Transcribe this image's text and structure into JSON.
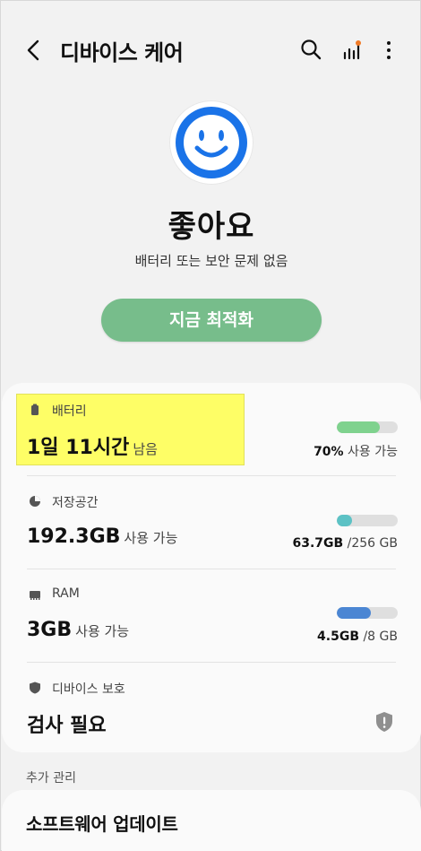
{
  "header": {
    "title": "디바이스 케어"
  },
  "status": {
    "title": "좋아요",
    "subtitle": "배터리 또는 보안 문제 없음",
    "button": "지금 최적화"
  },
  "items": {
    "battery": {
      "label": "배터리",
      "value": "1일 11시간",
      "value_suffix": "남음",
      "bar_fraction": 0.7,
      "bar_color": "#7fd28e",
      "right_bold": "70%",
      "right_muted": " 사용 가능"
    },
    "storage": {
      "label": "저장공간",
      "value": "192.3GB",
      "value_suffix": "사용 가능",
      "bar_fraction": 0.25,
      "bar_color": "#5cc2c5",
      "right_bold": "63.7GB",
      "right_muted": " /256 GB"
    },
    "ram": {
      "label": "RAM",
      "value": "3GB",
      "value_suffix": "사용 가능",
      "bar_fraction": 0.56,
      "bar_color": "#4b86d3",
      "right_bold": "4.5GB",
      "right_muted": " /8 GB"
    },
    "protection": {
      "label": "디바이스 보호",
      "value": "검사 필요"
    }
  },
  "extra": {
    "section_title": "추가 관리",
    "software_update": "소프트웨어 업데이트"
  },
  "colors": {
    "accent_blue": "#1a73e8",
    "button_green": "#77bd8b",
    "badge_orange": "#f07a26",
    "highlight_yellow": "#fefe66"
  }
}
